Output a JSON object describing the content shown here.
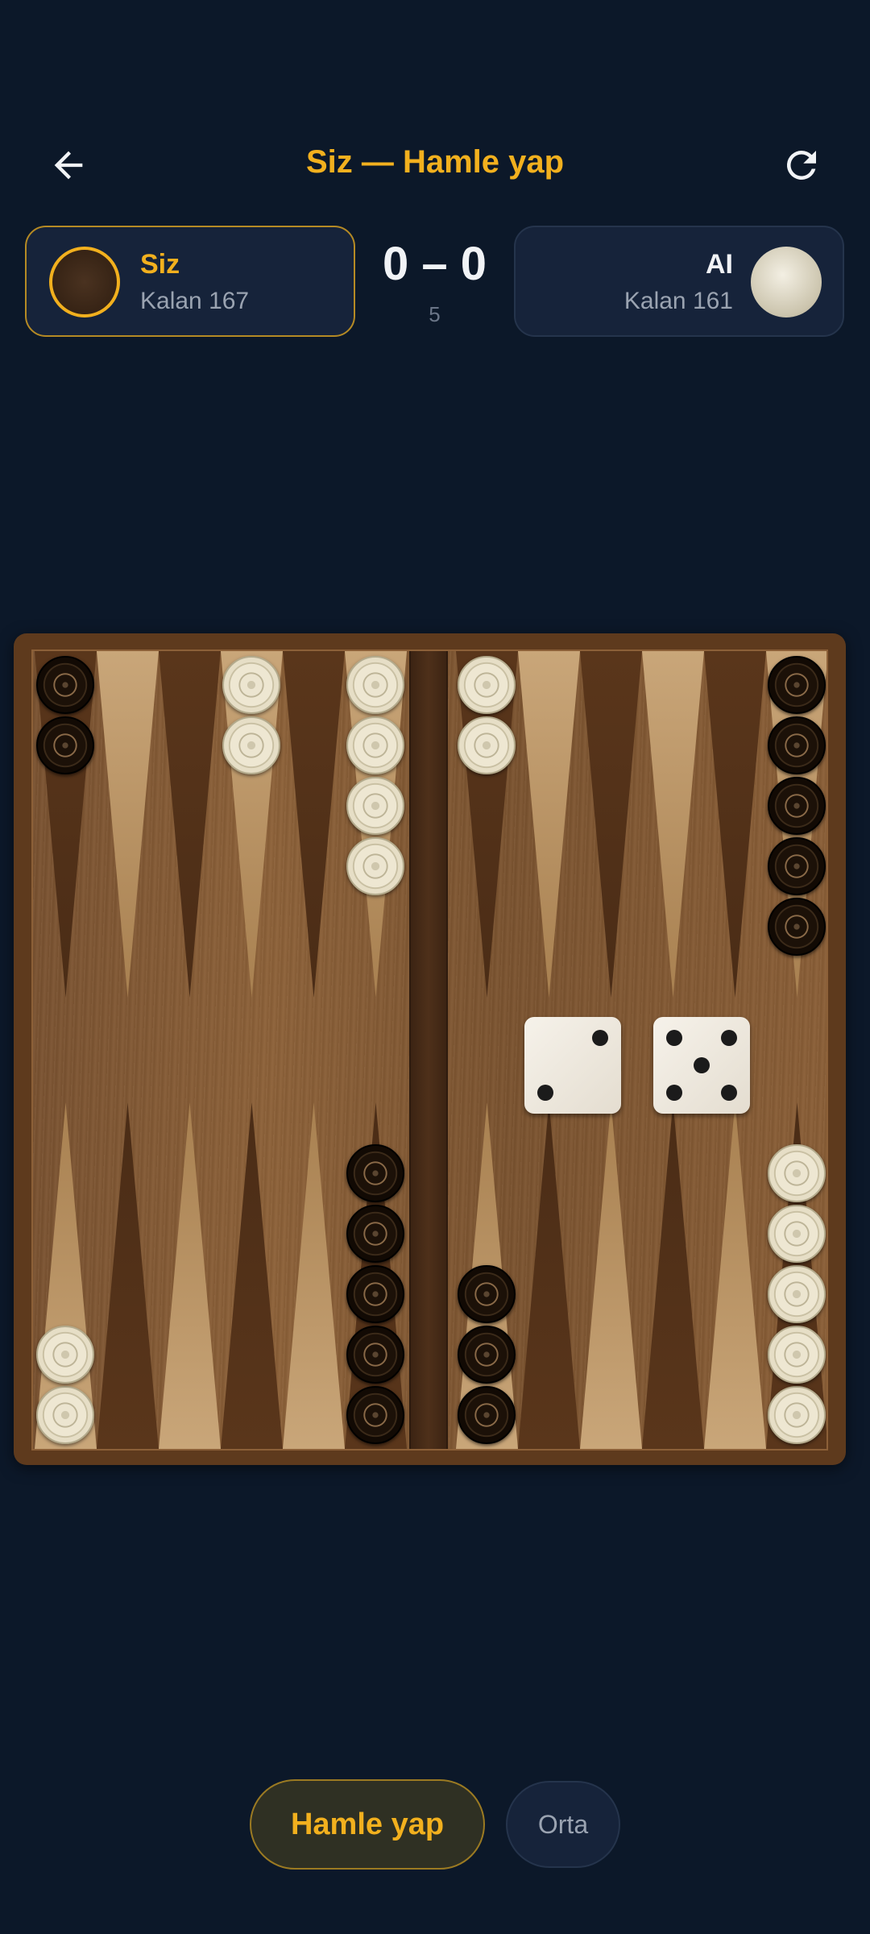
{
  "header": {
    "title": "Siz — Hamle yap",
    "back_icon": "arrow-left-icon",
    "refresh_icon": "refresh-icon"
  },
  "players": {
    "me": {
      "name": "Siz",
      "remaining": "Kalan 167"
    },
    "ai": {
      "name": "AI",
      "remaining": "Kalan 161"
    }
  },
  "score": {
    "text": "0 – 0",
    "sub": "5"
  },
  "dice": [
    2,
    5
  ],
  "board": {
    "top_points": [
      {
        "col": 1,
        "color": "black",
        "count": 2
      },
      {
        "col": 4,
        "color": "white",
        "count": 2
      },
      {
        "col": 6,
        "color": "white",
        "count": 4
      },
      {
        "col": 8,
        "color": "white",
        "count": 2
      },
      {
        "col": 13,
        "color": "black",
        "count": 5
      }
    ],
    "bottom_points": [
      {
        "col": 1,
        "color": "white",
        "count": 2
      },
      {
        "col": 6,
        "color": "black",
        "count": 5
      },
      {
        "col": 8,
        "color": "black",
        "count": 3
      },
      {
        "col": 13,
        "color": "white",
        "count": 5
      }
    ]
  },
  "actions": {
    "primary": "Hamle yap",
    "secondary": "Orta"
  },
  "colors": {
    "accent": "#f2b01e",
    "background": "#0c1829"
  }
}
